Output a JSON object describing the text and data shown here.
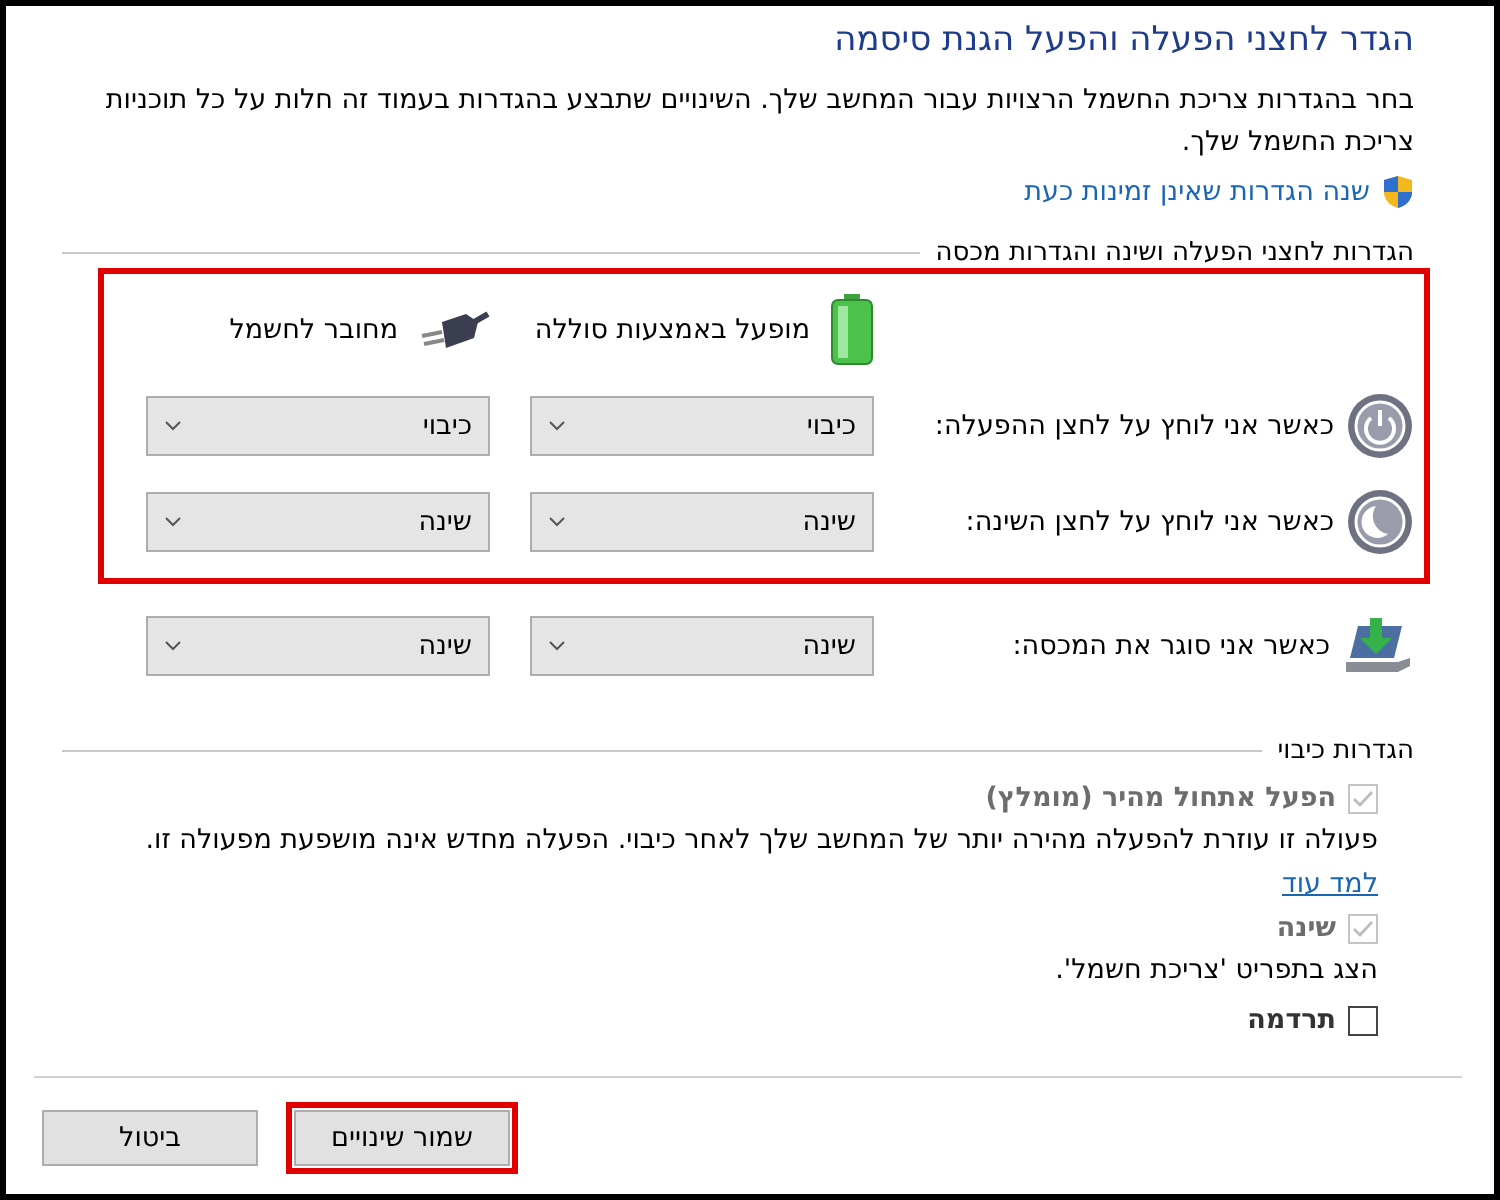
{
  "title": "הגדר לחצני הפעלה והפעל הגנת סיסמה",
  "description": "בחר בהגדרות צריכת החשמל הרצויות עבור המחשב שלך. השינויים שתבצע בהגדרות בעמוד זה חלות על כל תוכניות צריכת החשמל שלך.",
  "admin_link": "שנה הגדרות שאינן זמינות כעת",
  "buttons_section": {
    "heading": "הגדרות לחצני הפעלה ושינה והגדרות מכסה",
    "columns": [
      "מופעל באמצעות סוללה",
      "מחובר לחשמל"
    ],
    "rows": [
      {
        "kind": "power",
        "label": "כאשר אני לוחץ על לחצן ההפעלה:",
        "values": [
          "כיבוי",
          "כיבוי"
        ],
        "highlighted": true
      },
      {
        "kind": "sleep",
        "label": "כאשר אני לוחץ על לחצן השינה:",
        "values": [
          "שינה",
          "שינה"
        ],
        "highlighted": true
      },
      {
        "kind": "lid",
        "label": "כאשר אני סוגר את המכסה:",
        "values": [
          "שינה",
          "שינה"
        ],
        "highlighted": false
      }
    ]
  },
  "shutdown_section": {
    "heading": "הגדרות כיבוי",
    "options": [
      {
        "label": "הפעל אתחול מהיר (מומלץ)",
        "checked": true,
        "disabled": true,
        "description": "פעולה זו עוזרת להפעלה מהירה יותר של המחשב שלך לאחר כיבוי. הפעלה מחדש אינה מושפעת מפעולה זו.",
        "link": "למד עוד"
      },
      {
        "label": "שינה",
        "checked": true,
        "disabled": true,
        "description": "הצג בתפריט 'צריכת חשמל'."
      },
      {
        "label": "תרדמה",
        "checked": false,
        "disabled": false
      }
    ]
  },
  "footer_buttons": [
    {
      "label": "שמור שינויים",
      "highlighted": true
    },
    {
      "label": "ביטול",
      "highlighted": false
    }
  ]
}
